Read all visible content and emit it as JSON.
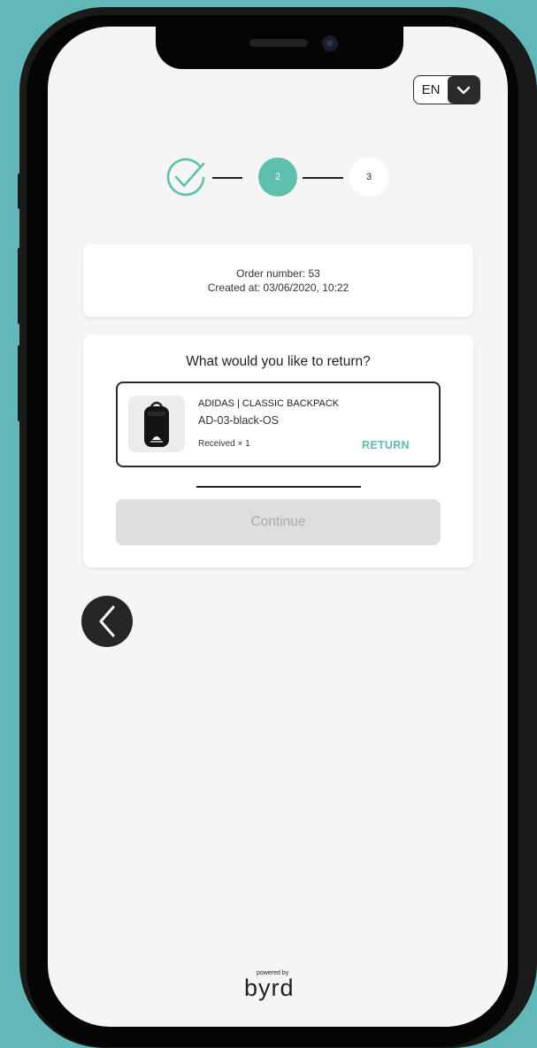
{
  "language": {
    "code": "EN",
    "icon": "chevron-down-icon"
  },
  "stepper": {
    "completed_icon": "check-circle-icon",
    "current_step": "2",
    "next_step": "3"
  },
  "order": {
    "number_text": "Order number: 53",
    "created_text": "Created at: 03/06/2020, 10:22"
  },
  "returns": {
    "question": "What would you like to return?",
    "items": [
      {
        "name": "ADIDAS | CLASSIC BACKPACK",
        "sku": "AD-03-black-OS",
        "quantity_text": "Received × 1",
        "action_label": "RETURN"
      }
    ],
    "continue_label": "Continue"
  },
  "navigation": {
    "back_icon": "chevron-left-icon"
  },
  "footer": {
    "powered_by": "powered by",
    "brand": "byrd"
  },
  "colors": {
    "accent": "#5dbfac",
    "background": "#62b8b9",
    "screen": "#f5f5f5",
    "dark": "#2b2b2b"
  }
}
